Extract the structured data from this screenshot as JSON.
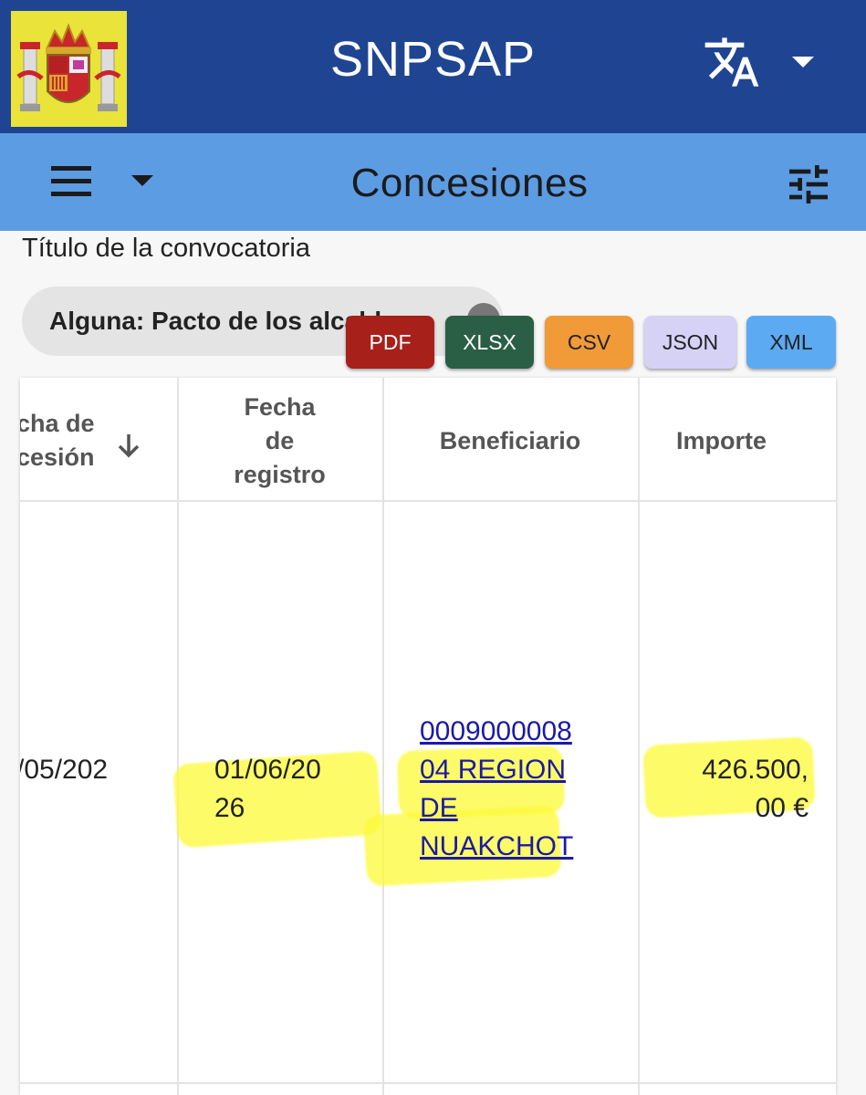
{
  "app": {
    "title": "SNPSAP",
    "translate_icon": "translate-icon",
    "lang_dropdown_icon": "caret-down-icon"
  },
  "toolbar": {
    "title": "Concesiones",
    "menu_icon": "menu-icon",
    "filter_icon": "tune-icon"
  },
  "filter": {
    "label": "Título de la convocatoria",
    "chip_text": "Alguna: Pacto de los alcaldes",
    "chip_close_icon": "close-icon"
  },
  "export_buttons": [
    "PDF",
    "XLSX",
    "CSV",
    "JSON",
    "XML"
  ],
  "table": {
    "columns": [
      {
        "label_line1": "cha de",
        "label_line2": "cesión",
        "sort_icon": "arrow-down-icon"
      },
      {
        "label_line1": "Fecha",
        "label_line2": "de",
        "label_line3": "registro"
      },
      {
        "label": "Beneficiario"
      },
      {
        "label": "Importe"
      }
    ],
    "rows": [
      {
        "fecha_concesion": "/05/202",
        "fecha_registro_l1": "01/06/20",
        "fecha_registro_l2": "26",
        "beneficiario_l1": "0009000008",
        "beneficiario_l2": "04 REGION",
        "beneficiario_l3": "DE",
        "beneficiario_l4": "NUAKCHOT",
        "importe_l1": "426.500,",
        "importe_l2": "00 €"
      }
    ]
  },
  "colors": {
    "appbar": "#1f4592",
    "subbar": "#5c9ce3",
    "pdf": "#a8201a",
    "xlsx": "#2a5f45",
    "csv": "#f09a38",
    "json": "#d5d2f6",
    "xml": "#5caaf2",
    "link": "#1a1aa6",
    "highlight": "#fcfa3c"
  }
}
